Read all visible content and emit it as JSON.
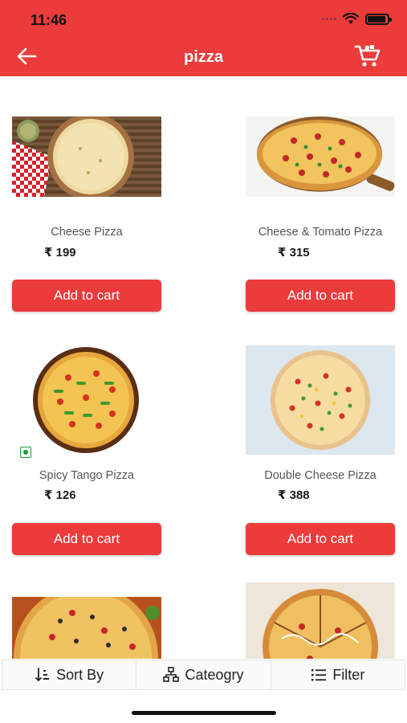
{
  "status_bar": {
    "time": "11:46"
  },
  "header": {
    "title": "pizza",
    "accent_color": "#ec3b3b"
  },
  "products": [
    {
      "name": "Cheese Pizza",
      "price": "₹ 199",
      "button": "Add to cart",
      "image": "pizza-top-view-on-board"
    },
    {
      "name": "Cheese & Tomato Pizza",
      "price": "₹ 315",
      "button": "Add to cart",
      "image": "pizza-on-wooden-paddle"
    },
    {
      "name": "Spicy Tango Pizza",
      "price": "₹ 126",
      "button": "Add to cart",
      "image": "pizza-round-veg",
      "veg": true
    },
    {
      "name": "Double Cheese Pizza",
      "price": "₹ 388",
      "button": "Add to cart",
      "image": "pizza-veg-on-paper"
    },
    {
      "name": "",
      "price": "",
      "button": "",
      "image": "pizza-olives-partial"
    },
    {
      "name": "",
      "price": "",
      "button": "",
      "image": "pizza-sliced-partial"
    }
  ],
  "bottom_bar": {
    "sort": "Sort By",
    "category": "Cateogry",
    "filter": "Filter"
  }
}
